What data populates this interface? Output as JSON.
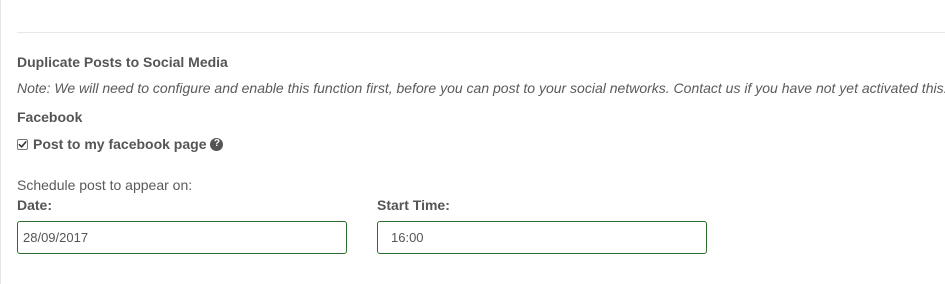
{
  "section": {
    "title": "Duplicate Posts to Social Media",
    "note": "Note: We will need to configure and enable this function first, before you can post to your social networks. Contact us if you have not yet activated this."
  },
  "facebook": {
    "title": "Facebook",
    "checkbox_label": "Post to my facebook page",
    "checked": true,
    "help_icon": "question-circle-icon"
  },
  "schedule": {
    "label": "Schedule post to appear on:",
    "date_label": "Date:",
    "date_value": "28/09/2017",
    "time_label": "Start Time:",
    "time_value": "16:00"
  },
  "colors": {
    "input_border": "#2e6b2e",
    "text": "#555555"
  }
}
